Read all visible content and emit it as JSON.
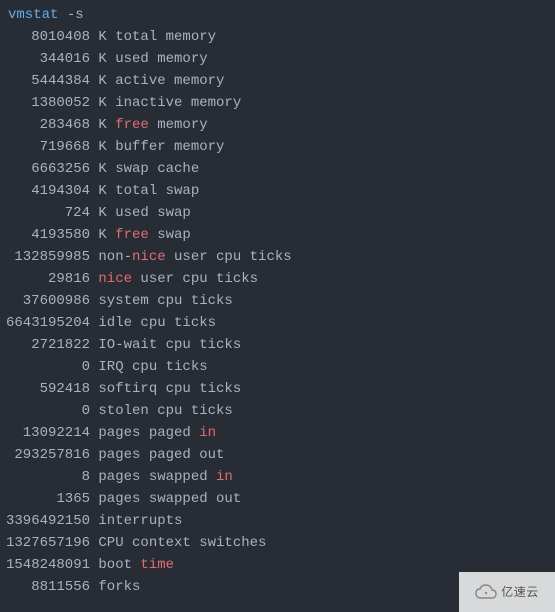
{
  "command": {
    "name": "vmstat",
    "arg": "-s"
  },
  "lines": [
    {
      "num": "8010408",
      "unit": "K",
      "pre": "",
      "kw": "",
      "post": "total memory"
    },
    {
      "num": "344016",
      "unit": "K",
      "pre": "",
      "kw": "",
      "post": "used memory"
    },
    {
      "num": "5444384",
      "unit": "K",
      "pre": "",
      "kw": "",
      "post": "active memory"
    },
    {
      "num": "1380052",
      "unit": "K",
      "pre": "",
      "kw": "",
      "post": "inactive memory"
    },
    {
      "num": "283468",
      "unit": "K",
      "pre": "",
      "kw": "free",
      "kwclass": "kw-free",
      "post": " memory"
    },
    {
      "num": "719668",
      "unit": "K",
      "pre": "",
      "kw": "",
      "post": "buffer memory"
    },
    {
      "num": "6663256",
      "unit": "K",
      "pre": "",
      "kw": "",
      "post": "swap cache"
    },
    {
      "num": "4194304",
      "unit": "K",
      "pre": "",
      "kw": "",
      "post": "total swap"
    },
    {
      "num": "724",
      "unit": "K",
      "pre": "",
      "kw": "",
      "post": "used swap"
    },
    {
      "num": "4193580",
      "unit": "K",
      "pre": "",
      "kw": "free",
      "kwclass": "kw-free",
      "post": " swap"
    },
    {
      "num": "132859985",
      "unit": "",
      "pre": "non-",
      "kw": "nice",
      "kwclass": "kw-nice",
      "post": " user cpu ticks"
    },
    {
      "num": "29816",
      "unit": "",
      "pre": "",
      "kw": "nice",
      "kwclass": "kw-nice",
      "post": " user cpu ticks"
    },
    {
      "num": "37600986",
      "unit": "",
      "pre": "",
      "kw": "",
      "post": "system cpu ticks"
    },
    {
      "num": "6643195204",
      "unit": "",
      "pre": "",
      "kw": "",
      "post": "idle cpu ticks"
    },
    {
      "num": "2721822",
      "unit": "",
      "pre": "",
      "kw": "",
      "post": "IO-wait cpu ticks"
    },
    {
      "num": "0",
      "unit": "",
      "pre": "",
      "kw": "",
      "post": "IRQ cpu ticks"
    },
    {
      "num": "592418",
      "unit": "",
      "pre": "",
      "kw": "",
      "post": "softirq cpu ticks"
    },
    {
      "num": "0",
      "unit": "",
      "pre": "",
      "kw": "",
      "post": "stolen cpu ticks"
    },
    {
      "num": "13092214",
      "unit": "",
      "pre": "pages paged ",
      "kw": "in",
      "kwclass": "kw-in",
      "post": ""
    },
    {
      "num": "293257816",
      "unit": "",
      "pre": "",
      "kw": "",
      "post": "pages paged out"
    },
    {
      "num": "8",
      "unit": "",
      "pre": "pages swapped ",
      "kw": "in",
      "kwclass": "kw-in",
      "post": ""
    },
    {
      "num": "1365",
      "unit": "",
      "pre": "",
      "kw": "",
      "post": "pages swapped out"
    },
    {
      "num": "3396492150",
      "unit": "",
      "pre": "",
      "kw": "",
      "post": "interrupts"
    },
    {
      "num": "1327657196",
      "unit": "",
      "pre": "",
      "kw": "",
      "post": "CPU context switches"
    },
    {
      "num": "1548248091",
      "unit": "",
      "pre": "boot ",
      "kw": "time",
      "kwclass": "kw-time",
      "post": ""
    },
    {
      "num": "8811556",
      "unit": "",
      "pre": "",
      "kw": "",
      "post": "forks"
    }
  ],
  "watermark": {
    "text": "亿速云"
  }
}
